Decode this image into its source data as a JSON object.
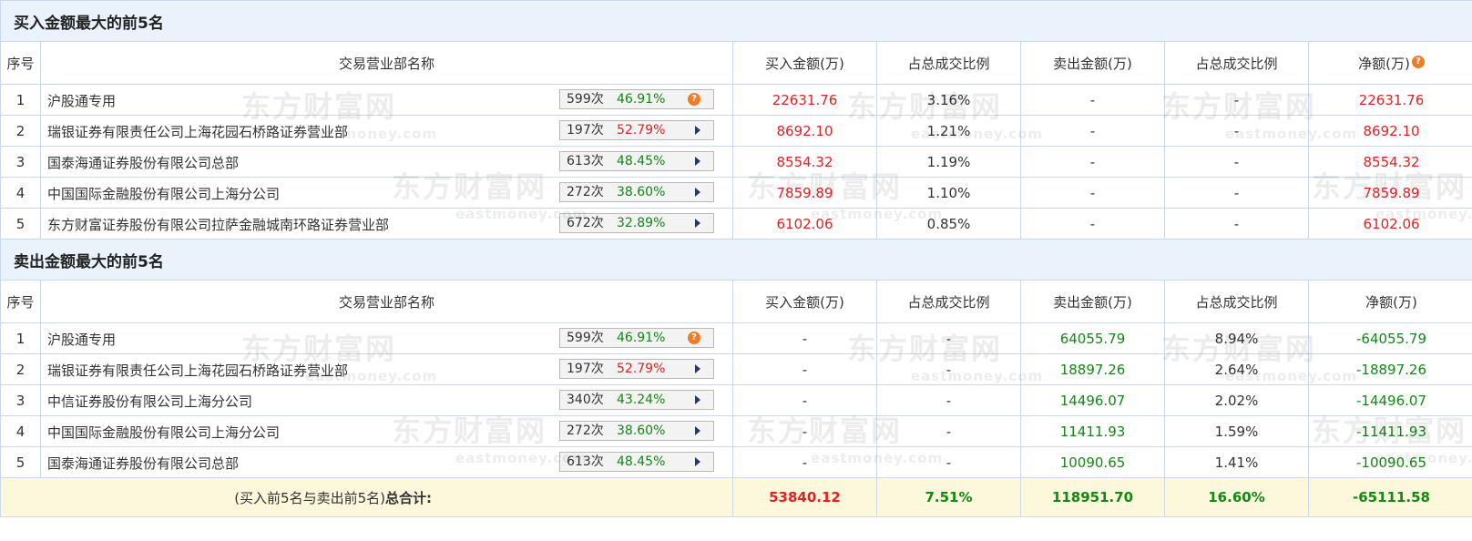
{
  "buy_section": {
    "title": "买入金额最大的前5名",
    "headers": [
      "序号",
      "交易营业部名称",
      "买入金额(万)",
      "占总成交比例",
      "卖出金额(万)",
      "占总成交比例",
      "净额(万)"
    ],
    "question_icon": "question-circle-icon",
    "rows": [
      {
        "seq": "1",
        "name": "沪股通专用",
        "count": "599次",
        "rate": "46.91%",
        "rate_color": "green",
        "icon": "question",
        "buy": "22631.76",
        "buy_ratio": "3.16%",
        "sell": "-",
        "sell_ratio": "-",
        "net": "22631.76",
        "net_color": "red"
      },
      {
        "seq": "2",
        "name": "瑞银证券有限责任公司上海花园石桥路证券营业部",
        "count": "197次",
        "rate": "52.79%",
        "rate_color": "red",
        "icon": "arrow",
        "buy": "8692.10",
        "buy_ratio": "1.21%",
        "sell": "-",
        "sell_ratio": "-",
        "net": "8692.10",
        "net_color": "red"
      },
      {
        "seq": "3",
        "name": "国泰海通证券股份有限公司总部",
        "count": "613次",
        "rate": "48.45%",
        "rate_color": "green",
        "icon": "arrow",
        "buy": "8554.32",
        "buy_ratio": "1.19%",
        "sell": "-",
        "sell_ratio": "-",
        "net": "8554.32",
        "net_color": "red"
      },
      {
        "seq": "4",
        "name": "中国国际金融股份有限公司上海分公司",
        "count": "272次",
        "rate": "38.60%",
        "rate_color": "green",
        "icon": "arrow",
        "buy": "7859.89",
        "buy_ratio": "1.10%",
        "sell": "-",
        "sell_ratio": "-",
        "net": "7859.89",
        "net_color": "red"
      },
      {
        "seq": "5",
        "name": "东方财富证券股份有限公司拉萨金融城南环路证券营业部",
        "count": "672次",
        "rate": "32.89%",
        "rate_color": "green",
        "icon": "arrow",
        "buy": "6102.06",
        "buy_ratio": "0.85%",
        "sell": "-",
        "sell_ratio": "-",
        "net": "6102.06",
        "net_color": "red"
      }
    ]
  },
  "sell_section": {
    "title": "卖出金额最大的前5名",
    "headers": [
      "序号",
      "交易营业部名称",
      "买入金额(万)",
      "占总成交比例",
      "卖出金额(万)",
      "占总成交比例",
      "净额(万)"
    ],
    "rows": [
      {
        "seq": "1",
        "name": "沪股通专用",
        "count": "599次",
        "rate": "46.91%",
        "rate_color": "green",
        "icon": "question",
        "buy": "-",
        "buy_ratio": "-",
        "sell": "64055.79",
        "sell_ratio": "8.94%",
        "net": "-64055.79",
        "net_color": "green"
      },
      {
        "seq": "2",
        "name": "瑞银证券有限责任公司上海花园石桥路证券营业部",
        "count": "197次",
        "rate": "52.79%",
        "rate_color": "red",
        "icon": "arrow",
        "buy": "-",
        "buy_ratio": "-",
        "sell": "18897.26",
        "sell_ratio": "2.64%",
        "net": "-18897.26",
        "net_color": "green"
      },
      {
        "seq": "3",
        "name": "中信证券股份有限公司上海分公司",
        "count": "340次",
        "rate": "43.24%",
        "rate_color": "green",
        "icon": "arrow",
        "buy": "-",
        "buy_ratio": "-",
        "sell": "14496.07",
        "sell_ratio": "2.02%",
        "net": "-14496.07",
        "net_color": "green"
      },
      {
        "seq": "4",
        "name": "中国国际金融股份有限公司上海分公司",
        "count": "272次",
        "rate": "38.60%",
        "rate_color": "green",
        "icon": "arrow",
        "buy": "-",
        "buy_ratio": "-",
        "sell": "11411.93",
        "sell_ratio": "1.59%",
        "net": "-11411.93",
        "net_color": "green"
      },
      {
        "seq": "5",
        "name": "国泰海通证券股份有限公司总部",
        "count": "613次",
        "rate": "48.45%",
        "rate_color": "green",
        "icon": "arrow",
        "buy": "-",
        "buy_ratio": "-",
        "sell": "10090.65",
        "sell_ratio": "1.41%",
        "net": "-10090.65",
        "net_color": "green"
      }
    ]
  },
  "total": {
    "label_pre": "(买入前5名与卖出前5名)",
    "label_bold": "总合计:",
    "buy": "53840.12",
    "buy_ratio": "7.51%",
    "sell": "118951.70",
    "sell_ratio": "16.60%",
    "net": "-65111.58"
  },
  "watermark": {
    "main": "东方财富网",
    "sub": "eastmoney.com"
  },
  "colors": {
    "red": "#e02222",
    "green": "#138813",
    "header_bg": "#eaf2fb",
    "total_bg": "#fdf8dc",
    "border": "#c9d8ea",
    "icon_orange": "#f07c28"
  }
}
